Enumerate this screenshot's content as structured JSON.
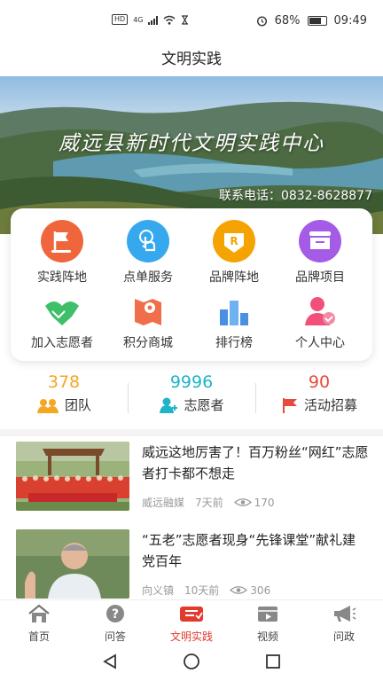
{
  "status_bar": {
    "network": "4G",
    "hd": "HD",
    "battery": "68%",
    "time": "09:49"
  },
  "header": {
    "title": "文明实践"
  },
  "banner": {
    "headline": "威远县新时代文明实践中心",
    "phone": "联系电话：0832-8628877"
  },
  "menu": {
    "items": [
      {
        "label": "实践阵地",
        "icon": "flag-icon",
        "color": "#f0663c"
      },
      {
        "label": "点单服务",
        "icon": "tap-icon",
        "color": "#36a9ee"
      },
      {
        "label": "品牌阵地",
        "icon": "r-badge-icon",
        "color": "#f5a300"
      },
      {
        "label": "品牌项目",
        "icon": "inbox-icon",
        "color": "#a45ce6"
      },
      {
        "label": "加入志愿者",
        "icon": "handshake-icon",
        "color": "#3fbf6a"
      },
      {
        "label": "积分商城",
        "icon": "map-pin-icon",
        "color": "#f06f4a"
      },
      {
        "label": "排行榜",
        "icon": "bar-rank-icon",
        "color": "#4a90e2"
      },
      {
        "label": "个人中心",
        "icon": "user-check-icon",
        "color": "#f0507a"
      }
    ]
  },
  "stats": {
    "team": {
      "value": "378",
      "label": "团队",
      "color": "#f5a623"
    },
    "volunteers": {
      "value": "9996",
      "label": "志愿者",
      "color": "#1fb4c8"
    },
    "recruit": {
      "value": "90",
      "label": "活动招募",
      "color": "#e64b3c"
    }
  },
  "news": [
    {
      "title": "威远这地厉害了！百万粉丝“网红”志愿者打卡都不想走",
      "source": "威远融媒",
      "time": "7天前",
      "views": "170"
    },
    {
      "title": "“五老”志愿者现身“先锋课堂”献礼建党百年",
      "source": "向义镇",
      "time": "10天前",
      "views": "306"
    }
  ],
  "bottom_nav": {
    "tabs": [
      {
        "label": "首页",
        "icon": "home-icon"
      },
      {
        "label": "问答",
        "icon": "question-icon"
      },
      {
        "label": "文明实践",
        "icon": "flag-stamp-icon",
        "active": true
      },
      {
        "label": "视频",
        "icon": "video-icon"
      },
      {
        "label": "问政",
        "icon": "megaphone-icon"
      }
    ]
  }
}
